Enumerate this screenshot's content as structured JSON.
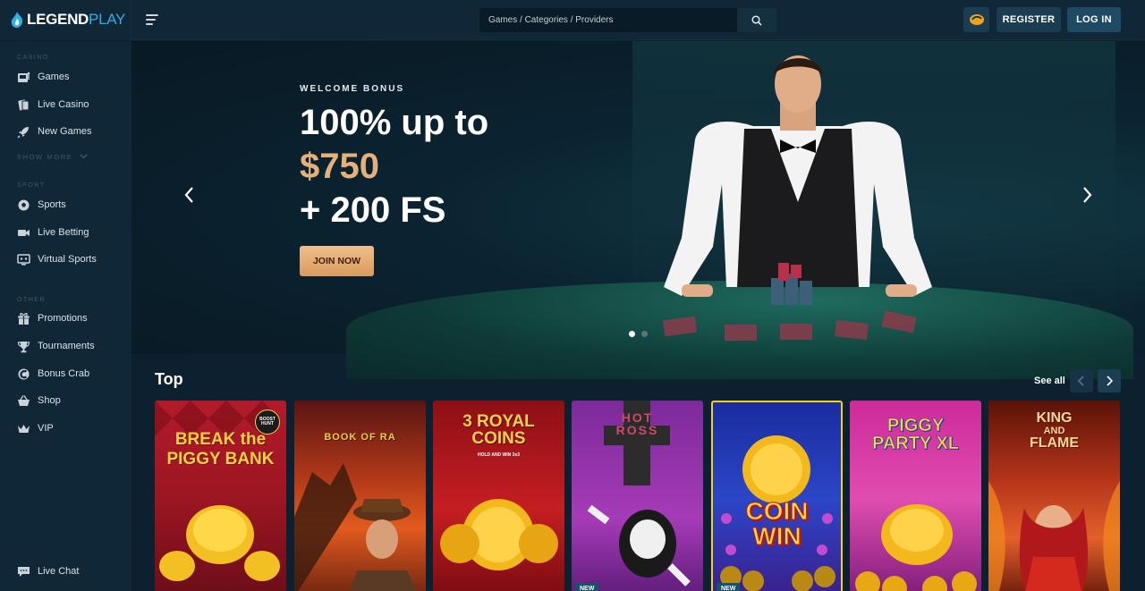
{
  "brand": {
    "part1": "LEGEND",
    "part2": "PLAY"
  },
  "search": {
    "placeholder": "Games / Categories / Providers"
  },
  "header": {
    "register_label": "REGISTER",
    "login_label": "LOG IN"
  },
  "sidebar": {
    "casino_heading": "CASINO",
    "casino_items": [
      {
        "label": "Games",
        "icon": "slot-machine-icon"
      },
      {
        "label": "Live Casino",
        "icon": "cards-icon"
      },
      {
        "label": "New Games",
        "icon": "rocket-icon"
      }
    ],
    "show_more": "SHOW MORE",
    "sport_heading": "SPORT",
    "sport_items": [
      {
        "label": "Sports",
        "icon": "soccer-ball-icon"
      },
      {
        "label": "Live Betting",
        "icon": "video-camera-icon"
      },
      {
        "label": "Virtual Sports",
        "icon": "monitor-icon"
      }
    ],
    "other_heading": "OTHER",
    "other_items": [
      {
        "label": "Promotions",
        "icon": "gift-icon"
      },
      {
        "label": "Tournaments",
        "icon": "trophy-icon"
      },
      {
        "label": "Bonus Crab",
        "icon": "crab-icon"
      },
      {
        "label": "Shop",
        "icon": "basket-icon"
      },
      {
        "label": "VIP",
        "icon": "crown-icon"
      }
    ],
    "live_chat": "Live Chat"
  },
  "hero": {
    "kicker": "WELCOME BONUS",
    "line1": "100% up to",
    "line2": "$750",
    "line3": "+ 200 FS",
    "cta": "JOIN NOW",
    "slide_count": 2,
    "active_slide": 1
  },
  "top_section": {
    "title": "Top",
    "see_all": "See all",
    "games": [
      {
        "title_lines": [
          "BREAK the",
          "PIGGY BANK"
        ],
        "badge": "BOOST HUNT",
        "new": false
      },
      {
        "title_lines": [
          "BOOK OF RA"
        ],
        "badge": "",
        "new": false
      },
      {
        "title_lines": [
          "3 ROYAL",
          "COINS"
        ],
        "badge": "HOLD AND WIN 3x3",
        "new": false
      },
      {
        "title_lines": [
          "HOT",
          "ROSS"
        ],
        "badge": "",
        "new": true,
        "new_label": "NEW"
      },
      {
        "title_lines": [
          "COIN",
          "WIN"
        ],
        "badge": "",
        "new": true,
        "new_label": "NEW"
      },
      {
        "title_lines": [
          "PIGGY",
          "PARTY XL"
        ],
        "badge": "",
        "new": false
      },
      {
        "title_lines": [
          "KING",
          "AND",
          "FLAME"
        ],
        "badge": "",
        "new": false
      }
    ]
  },
  "colors": {
    "accent_blue": "#2fb0e8",
    "cta_gold": "#e5b07a",
    "coin_win_border": "#f3d21c"
  }
}
